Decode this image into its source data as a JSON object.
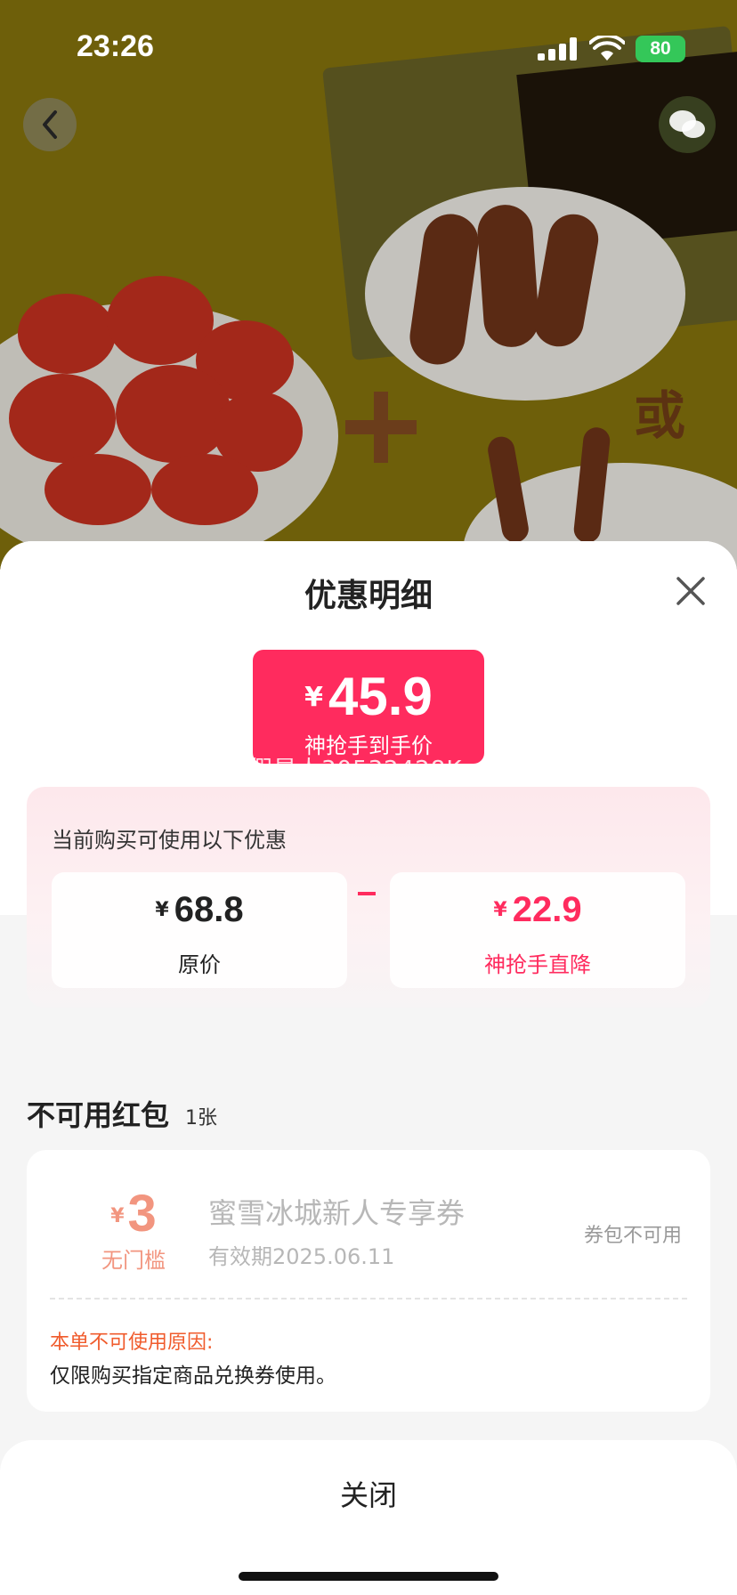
{
  "status_bar": {
    "time": "23:26",
    "battery": "80"
  },
  "background": {
    "overlay_char": "或"
  },
  "sheet": {
    "title": "优惠明细",
    "final_price": {
      "currency": "¥",
      "amount": "45.9",
      "label": "神抢手到手价"
    },
    "watermark": "假星人30532428K.",
    "breakdown": {
      "hint": "当前购买可使用以下优惠",
      "original": {
        "currency": "¥",
        "amount": "68.8",
        "label": "原价"
      },
      "discount": {
        "currency": "¥",
        "amount": "22.9",
        "label": "神抢手直降"
      }
    },
    "unavailable": {
      "title": "不可用红包",
      "count": "1张",
      "coupon": {
        "currency": "¥",
        "amount": "3",
        "threshold": "无门槛",
        "name": "蜜雪冰城新人专享券",
        "validity": "有效期2025.06.11",
        "status": "券包不可用",
        "reason_title": "本单不可使用原因:",
        "reason": "仅限购买指定商品兑换券使用。"
      }
    },
    "close_label": "关闭"
  },
  "colors": {
    "accent": "#ff2b5e",
    "coupon_amount": "#f2957f",
    "reason": "#f05b2c",
    "battery": "#34c759"
  }
}
